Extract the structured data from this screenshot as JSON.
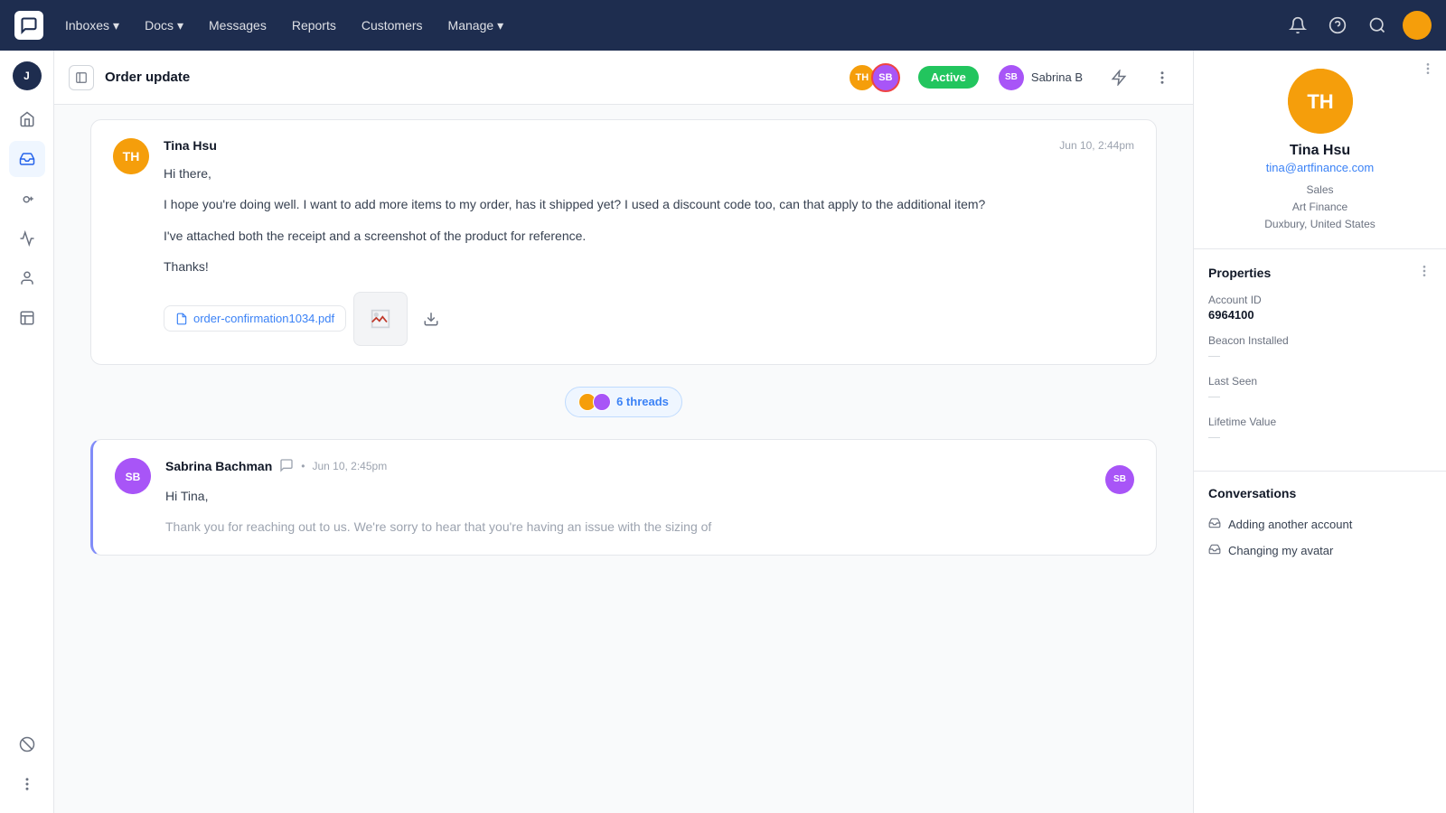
{
  "topnav": {
    "logo_label": "Chatwoot",
    "nav_items": [
      {
        "label": "Inboxes",
        "has_dropdown": true
      },
      {
        "label": "Docs",
        "has_dropdown": true
      },
      {
        "label": "Messages"
      },
      {
        "label": "Reports"
      },
      {
        "label": "Customers"
      },
      {
        "label": "Manage",
        "has_dropdown": true
      }
    ]
  },
  "sidebar": {
    "user_initial": "J",
    "items": [
      {
        "icon": "home-icon",
        "label": "Home",
        "active": false
      },
      {
        "icon": "inbox-icon",
        "label": "Inbox",
        "active": true
      },
      {
        "icon": "hand-icon",
        "label": "Mentions",
        "active": false
      },
      {
        "icon": "report-icon",
        "label": "Reports",
        "active": false
      },
      {
        "icon": "contact-icon",
        "label": "Contacts",
        "active": false
      },
      {
        "icon": "label-icon",
        "label": "Labels",
        "active": false
      },
      {
        "icon": "ban-icon",
        "label": "Settings",
        "active": false
      },
      {
        "icon": "more-icon",
        "label": "More",
        "active": false
      }
    ]
  },
  "conversation": {
    "title": "Order update",
    "status": "Active",
    "assignee": "Sabrina B",
    "agents": [
      "TH",
      "SB"
    ]
  },
  "messages": [
    {
      "id": "msg1",
      "sender": "Tina Hsu",
      "time": "Jun 10, 2:44pm",
      "body_paragraphs": [
        "Hi there,",
        "I hope you're doing well. I want to add more items to my order, has it shipped yet? I used a discount code too, can that apply to the additional item?",
        "I've attached both the receipt and a screenshot of the product for reference.",
        "Thanks!"
      ],
      "attachment_file": "order-confirmation1034.pdf",
      "has_image_attachment": true,
      "has_download": true
    }
  ],
  "threads": {
    "count": 6,
    "label": "6 threads"
  },
  "reply_message": {
    "sender": "Sabrina Bachman",
    "time": "Jun 10, 2:45pm",
    "body_paragraphs": [
      "Hi Tina,",
      "Thank you for reaching out to us. We're sorry to hear that you're having an issue with the sizing of"
    ]
  },
  "right_panel": {
    "contact": {
      "name": "Tina Hsu",
      "email": "tina@artfinance.com",
      "role": "Sales",
      "company": "Art Finance",
      "location": "Duxbury, United States"
    },
    "properties": {
      "title": "Properties",
      "account_id_label": "Account ID",
      "account_id_value": "6964100",
      "beacon_installed_label": "Beacon Installed",
      "beacon_installed_value": "—",
      "last_seen_label": "Last Seen",
      "last_seen_value": "—",
      "lifetime_value_label": "Lifetime Value",
      "lifetime_value_value": "—"
    },
    "conversations": {
      "title": "Conversations",
      "items": [
        {
          "label": "Adding another account"
        },
        {
          "label": "Changing my avatar"
        }
      ]
    }
  }
}
